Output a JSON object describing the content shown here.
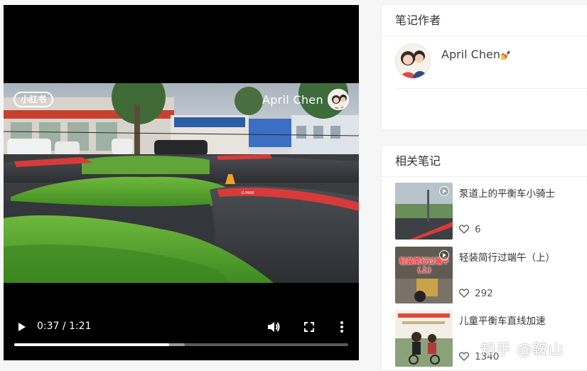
{
  "player": {
    "watermark_logo": "小红书",
    "watermark_name": "April Chen",
    "time_display": "0:37 / 1:21",
    "progress_fraction": 0.463,
    "buffered_fraction": 0.51
  },
  "author_card": {
    "title": "笔记作者",
    "name": "April Chen",
    "name_emoji": "💅"
  },
  "related_card": {
    "title": "相关笔记",
    "notes": [
      {
        "title": "泵道上的平衡车小骑士",
        "likes": "6"
      },
      {
        "title": "轻装简行过端午（上）",
        "likes": "292",
        "thumb_caption": "轻装简行过端午(上)"
      },
      {
        "title": "儿童平衡车直线加速",
        "likes": "1340"
      }
    ]
  },
  "page_watermark": "知乎 @鞍山",
  "colors": {
    "player_bg": "#000000",
    "track_red": "#d83a3a",
    "grass": "#4f9a2c"
  }
}
